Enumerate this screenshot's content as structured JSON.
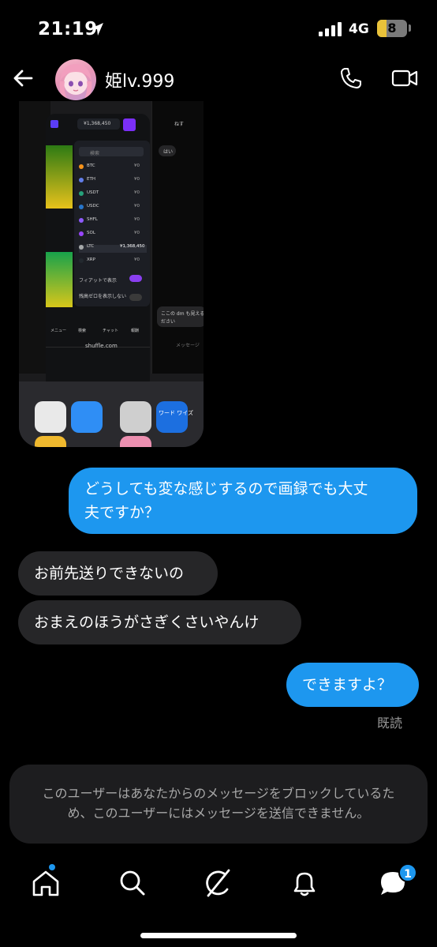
{
  "status_bar": {
    "time": "21:19",
    "network": "4G",
    "battery": "8",
    "battery_level": 0.08,
    "icons": [
      "location-arrow-icon",
      "signal-icon",
      "battery-icon"
    ]
  },
  "header": {
    "username": "姫lv.999",
    "icons": [
      "back-arrow-icon",
      "phone-icon",
      "video-camera-icon"
    ]
  },
  "shared_image": {
    "wallet_balance": "¥1,368,450",
    "search_placeholder": "検索",
    "coins": [
      {
        "symbol": "BTC",
        "value": "¥0",
        "color": "#f7931a"
      },
      {
        "symbol": "ETH",
        "value": "¥0",
        "color": "#627eea"
      },
      {
        "symbol": "USDT",
        "value": "¥0",
        "color": "#26a17b"
      },
      {
        "symbol": "USDC",
        "value": "¥0",
        "color": "#2775ca"
      },
      {
        "symbol": "SHFL",
        "value": "¥0",
        "color": "#8f5bff"
      },
      {
        "symbol": "SOL",
        "value": "¥0",
        "color": "#9945ff"
      },
      {
        "symbol": "LTC",
        "value": "¥1,368,450",
        "color": "#a6a9aa"
      },
      {
        "symbol": "XRP",
        "value": "¥0",
        "color": "#23292f"
      }
    ],
    "fiat_toggle": "フィアットで表示",
    "zero_balance_toggle": "残高ゼロを表示しない",
    "nav_labels": [
      "メニュー",
      "検索",
      "チャット",
      "報酬"
    ],
    "url": "shuffle.com",
    "chat_name": "ねす",
    "chat_message": "はい",
    "chat_message_2": "ここの dm も見える",
    "chat_message_3": "ださい",
    "chat_input_placeholder": "メッセージ",
    "app_label": "ワード ワイズ"
  },
  "messages": [
    {
      "direction": "out",
      "text_line1": "どうしても変な感じするので画録でも大丈",
      "text_line2": "夫ですか？"
    },
    {
      "direction": "in",
      "text": "お前先送りできないの"
    },
    {
      "direction": "in",
      "text": "おまえのほうがさぎくさいやんけ"
    },
    {
      "direction": "out",
      "text": "できますよ？"
    }
  ],
  "read_receipt": "既読",
  "blocked_notice": {
    "line1": "このユーザーはあなたからのメッセージをブロックしているた",
    "line2": "め、このユーザーにはメッセージを送信できません。"
  },
  "bottom_nav": {
    "items": [
      "home-icon",
      "search-icon",
      "grok-icon",
      "notifications-icon",
      "messages-icon"
    ],
    "messages_badge": "1"
  },
  "colors": {
    "accent": "#1d97ef",
    "bubble_in": "#262628",
    "background": "#000000"
  }
}
